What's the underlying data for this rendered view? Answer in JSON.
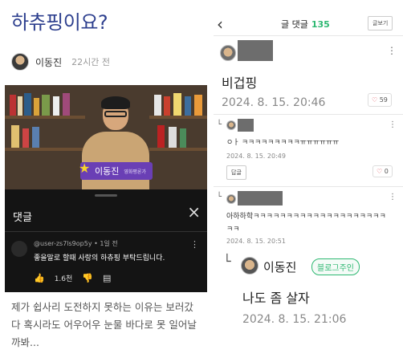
{
  "left": {
    "post_title": "하츄핑이요?",
    "author": {
      "name": "이동진",
      "time": "22시간 전"
    },
    "video": {
      "name_tag": "이동진",
      "name_tag_sub": "영화평론가"
    },
    "comments_panel": {
      "title": "댓글",
      "close_icon": "×",
      "comment": {
        "meta": "@user-zs7ls9op5y • 1일 전",
        "text": "좋을말로 할때 사랑의 하츄핑 부탁드립니다.",
        "likes": "1.6천",
        "more": "⋮"
      }
    },
    "caption": "제가 쉽사리 도전하지 못하는 이유는 보러갔다 혹시라도 어우어우 눈물 바다로 못 일어날까봐..."
  },
  "right": {
    "header": {
      "title": "글 댓글",
      "count": "135",
      "write_button": "글보기"
    },
    "comments": [
      {
        "text": "비겁핑",
        "date": "2024. 8. 15. 20:46",
        "likes": "59"
      }
    ],
    "replies": [
      {
        "text": "ㅇㅏ ㅋㅋㅋㅋㅋㅋㅋㅋㅋㅠㅠㅠㅠㅠㅠ",
        "date": "2024. 8. 15. 20:49",
        "reply_button": "답글",
        "likes": "0"
      },
      {
        "text": "아하하학ㅋㅋㅋㅋㅋㅋㅋㅋㅋㅋㅋㅋㅋㅋㅋㅋㅋㅋㅋㅋㅋㅋ",
        "date": "2024. 8. 15. 20:51"
      },
      {
        "name": "이동진",
        "badge": "블로그주인",
        "text": "나도 좀 살자",
        "date": "2024. 8. 15. 21:06"
      }
    ]
  },
  "colors": {
    "title_blue": "#2d3f8e",
    "accent_green": "#2eb872",
    "heart_red": "#e0505a"
  }
}
